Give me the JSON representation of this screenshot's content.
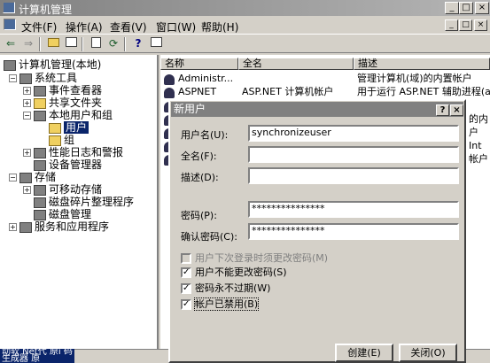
{
  "window": {
    "title": "计算机管理",
    "minimize": "_",
    "maximize": "□",
    "close": "×"
  },
  "menubar": {
    "items": [
      "文件(F)",
      "操作(A)",
      "查看(V)",
      "窗口(W)",
      "帮助(H)"
    ]
  },
  "tree": {
    "root": "计算机管理(本地)",
    "system_tools": "系统工具",
    "event_viewer": "事件查看器",
    "shared_folders": "共享文件夹",
    "local_users": "本地用户和组",
    "users": "用户",
    "groups": "组",
    "perf_logs": "性能日志和警报",
    "device_manager": "设备管理器",
    "storage": "存储",
    "removable": "可移动存储",
    "defrag": "磁盘碎片整理程序",
    "disk_mgmt": "磁盘管理",
    "services": "服务和应用程序"
  },
  "list": {
    "columns": [
      "名称",
      "全名",
      "描述"
    ],
    "rows": [
      {
        "name": "Administr...",
        "fullname": "",
        "desc": "管理计算机(域)的内置帐户"
      },
      {
        "name": "ASPNET",
        "fullname": "ASP.NET 计算机帐户",
        "desc": "用于运行 ASP.NET 辅助进程(as"
      }
    ],
    "partial_desc": [
      "的内",
      "户",
      "Int",
      "帐户"
    ]
  },
  "status": {
    "fragment": "动软 Net代 原i 码生成器 原"
  },
  "dialog": {
    "title": "新用户",
    "help": "?",
    "close": "×",
    "username_label": "用户名(U):",
    "username_value": "synchronizeuser",
    "fullname_label": "全名(F):",
    "fullname_value": "",
    "description_label": "描述(D):",
    "description_value": "",
    "password_label": "密码(P):",
    "password_value": "***************",
    "confirm_label": "确认密码(C):",
    "confirm_value": "***************",
    "cb_must_change": "用户下次登录时须更改密码(M)",
    "cb_cannot_change": "用户不能更改密码(S)",
    "cb_never_expires": "密码永不过期(W)",
    "cb_disabled": "帐户已禁用(B)",
    "check_mark": "✓",
    "create_button": "创建(E)",
    "close_button": "关闭(O)"
  }
}
